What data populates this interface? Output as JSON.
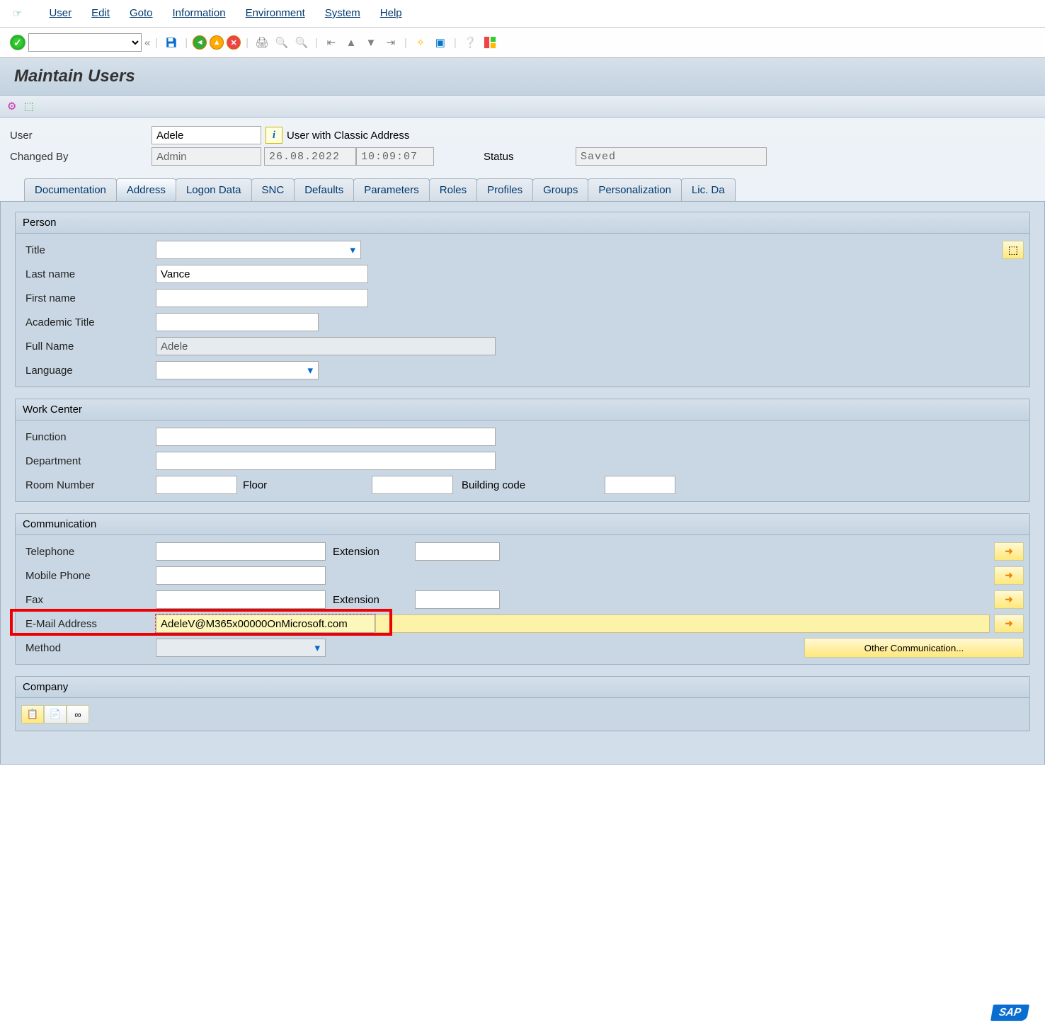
{
  "menu": {
    "user": "User",
    "edit": "Edit",
    "goto": "Goto",
    "information": "Information",
    "environment": "Environment",
    "system": "System",
    "help": "Help"
  },
  "title": "Maintain Users",
  "header": {
    "user_label": "User",
    "user_value": "Adele",
    "classic_addr": "User with Classic Address",
    "changedby_label": "Changed By",
    "changedby_value": "Admin",
    "date": "26.08.2022",
    "time": "10:09:07",
    "status_label": "Status",
    "status_value": "Saved"
  },
  "tabs": {
    "documentation": "Documentation",
    "address": "Address",
    "logon": "Logon Data",
    "snc": "SNC",
    "defaults": "Defaults",
    "parameters": "Parameters",
    "roles": "Roles",
    "profiles": "Profiles",
    "groups": "Groups",
    "personalization": "Personalization",
    "licdata": "Lic. Da"
  },
  "person": {
    "header": "Person",
    "title": "Title",
    "lastname_label": "Last name",
    "lastname": "Vance",
    "firstname_label": "First name",
    "firstname": "",
    "acad_label": "Academic Title",
    "acad": "",
    "fullname_label": "Full Name",
    "fullname": "Adele",
    "language_label": "Language",
    "language": ""
  },
  "work": {
    "header": "Work Center",
    "function_label": "Function",
    "function": "",
    "dept_label": "Department",
    "dept": "",
    "room_label": "Room Number",
    "room": "",
    "floor_label": "Floor",
    "floor": "",
    "building_label": "Building code",
    "building": ""
  },
  "comm": {
    "header": "Communication",
    "tel_label": "Telephone",
    "tel": "",
    "ext_label": "Extension",
    "tel_ext": "",
    "mobile_label": "Mobile Phone",
    "mobile": "",
    "fax_label": "Fax",
    "fax": "",
    "fax_ext": "",
    "email_label": "E-Mail Address",
    "email": "AdeleV@M365x00000OnMicrosoft.com",
    "method_label": "Method",
    "method": "",
    "other": "Other Communication..."
  },
  "company": {
    "header": "Company"
  }
}
